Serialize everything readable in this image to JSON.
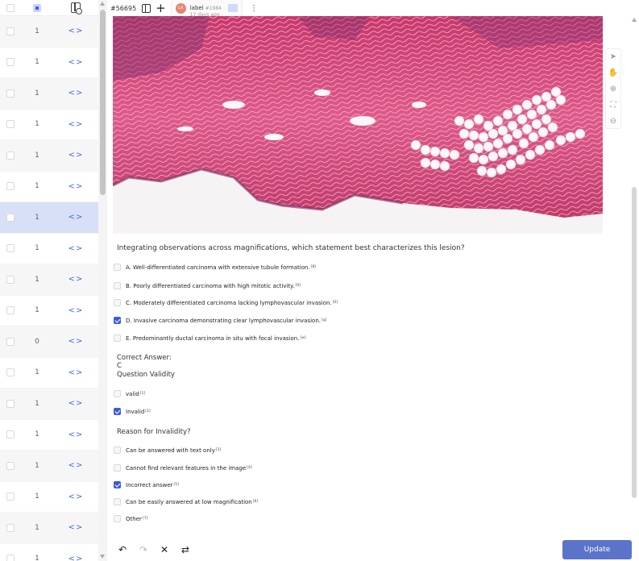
{
  "toolbar": {
    "task_id": "#56695",
    "annotation": {
      "avatar_initials": "LA",
      "label": "label",
      "id": "#1984",
      "time": "17 days ago"
    }
  },
  "task_list": {
    "rows": [
      {
        "count": "1",
        "code": "<>"
      },
      {
        "count": "1",
        "code": "<>"
      },
      {
        "count": "1",
        "code": "<>"
      },
      {
        "count": "1",
        "code": "<>"
      },
      {
        "count": "1",
        "code": "<>"
      },
      {
        "count": "1",
        "code": "<>"
      },
      {
        "count": "1",
        "code": "<>",
        "selected": true
      },
      {
        "count": "1",
        "code": "<>"
      },
      {
        "count": "1",
        "code": "<>"
      },
      {
        "count": "1",
        "code": "<>"
      },
      {
        "count": "0",
        "code": "<>"
      },
      {
        "count": "1",
        "code": "<>"
      },
      {
        "count": "1",
        "code": "<>"
      },
      {
        "count": "1",
        "code": "<>"
      },
      {
        "count": "1",
        "code": "<>"
      },
      {
        "count": "1",
        "code": "<>"
      },
      {
        "count": "1",
        "code": "<>"
      },
      {
        "count": "1",
        "code": "<>"
      }
    ]
  },
  "question": {
    "text": "Integrating observations across magnifications, which statement best characterizes this lesion?",
    "options": [
      {
        "text": "A. Well-differentiated carcinoma with extensive tubule formation.",
        "hotkey": "[8]",
        "checked": false
      },
      {
        "text": "B. Poorly differentiated carcinoma with high mitotic activity.",
        "hotkey": "[9]",
        "checked": false
      },
      {
        "text": "C. Moderately differentiated carcinoma lacking lymphovascular invasion.",
        "hotkey": "[0]",
        "checked": false
      },
      {
        "text": "D. Invasive carcinoma demonstrating clear lymphovascular invasion.",
        "hotkey": "[q]",
        "checked": true
      },
      {
        "text": "E. Predominantly ductal carcinoma in situ with focal invasion.",
        "hotkey": "[w]",
        "checked": false
      }
    ]
  },
  "answer": {
    "label": "Correct Answer:",
    "value": "C"
  },
  "validity": {
    "label": "Question Validity",
    "options": [
      {
        "text": "valid",
        "hotkey": "[1]",
        "checked": false
      },
      {
        "text": "Invalid",
        "hotkey": "[2]",
        "checked": true
      }
    ]
  },
  "reason": {
    "label": "Reason for Invalidity?",
    "options": [
      {
        "text": "Can be answered with text only",
        "hotkey": "[3]",
        "checked": false
      },
      {
        "text": "Cannot find relevant features in the image",
        "hotkey": "[4]",
        "checked": false
      },
      {
        "text": "Incorrect answer",
        "hotkey": "[5]",
        "checked": true
      },
      {
        "text": "Can be easily answered at low magnification",
        "hotkey": "[6]",
        "checked": false
      },
      {
        "text": "Other",
        "hotkey": "[7]",
        "checked": false
      }
    ]
  },
  "bottom": {
    "update_label": "Update"
  },
  "colors": {
    "accent": "#5b73c9",
    "checkbox_checked": "#3d5bd9",
    "selected_row": "#d8e0f7",
    "tissue_pink": "#d9487a"
  }
}
